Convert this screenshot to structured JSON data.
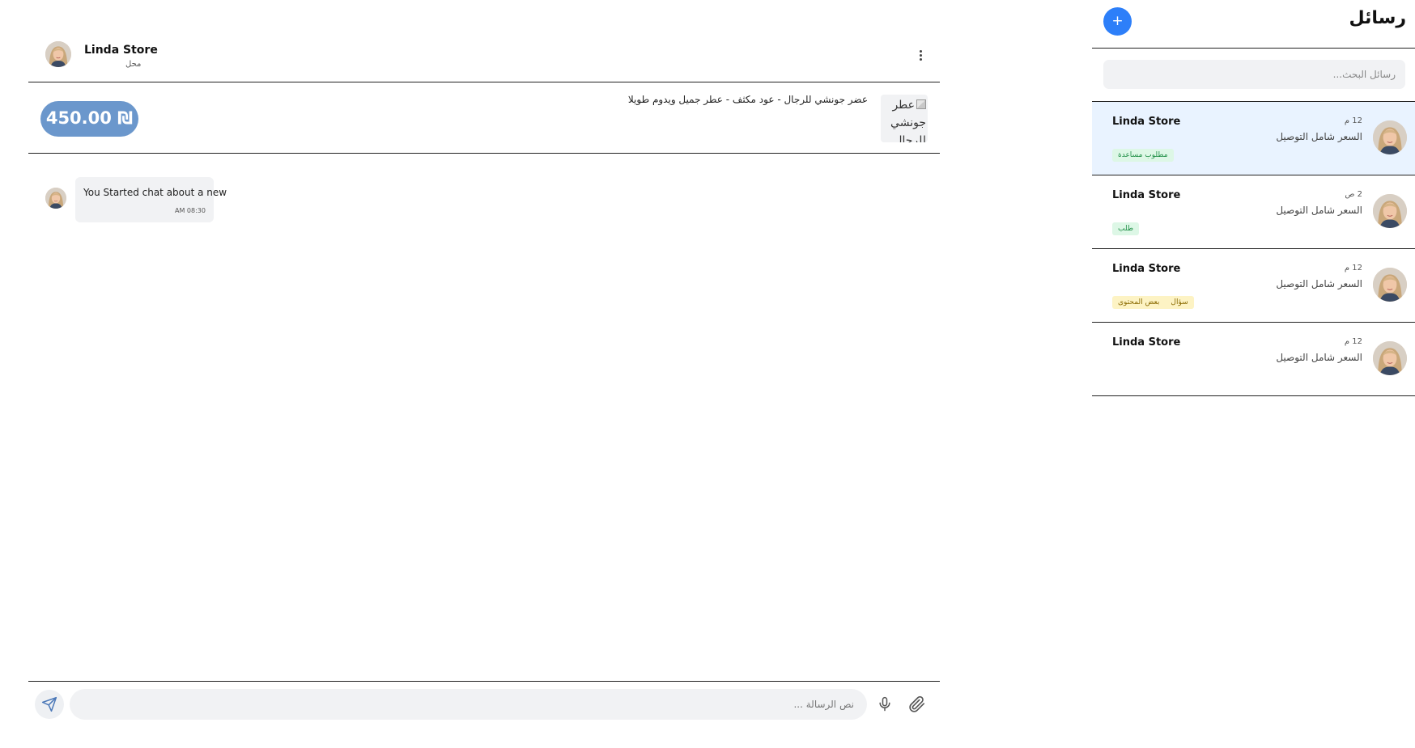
{
  "sidebar": {
    "title": "رسائل",
    "new_button_label": "+",
    "search_placeholder": "رسائل البحث...",
    "conversations": [
      {
        "name": "Linda Store",
        "time": "12 م",
        "preview": "السعر شامل التوصيل",
        "tags": [
          "مطلوب مساعدة"
        ],
        "tag_colors": [
          "green"
        ],
        "active": true
      },
      {
        "name": "Linda Store",
        "time": "2 ص",
        "preview": "السعر شامل التوصيل",
        "tags": [
          "طلب"
        ],
        "tag_colors": [
          "green"
        ],
        "active": false
      },
      {
        "name": "Linda Store",
        "time": "12 م",
        "preview": "السعر شامل التوصيل",
        "tags": [
          "سؤال",
          "بعض المحتوى"
        ],
        "tag_colors": [
          "yellow"
        ],
        "active": false
      },
      {
        "name": "Linda Store",
        "time": "12 م",
        "preview": "السعر شامل التوصيل",
        "tags": [],
        "tag_colors": [],
        "active": false
      }
    ]
  },
  "chat": {
    "contact_name": "Linda Store",
    "contact_subtitle": "محل",
    "menu_icon": "more-vertical-icon",
    "product": {
      "title": "عضر جونشي للرجال - عود مكثف - عطر جميل ويدوم طويلا",
      "image_alt": "عطر جونشي للرجال -",
      "price": "450.00 ₪"
    },
    "messages": [
      {
        "text": "You Started chat about a new",
        "time": "AM 08:30"
      }
    ],
    "composer": {
      "placeholder": "نص الرسالة ...",
      "send_icon": "send-icon",
      "mic_icon": "microphone-icon",
      "attach_icon": "paperclip-icon"
    }
  },
  "colors": {
    "accent": "#2d7ff9",
    "price_pill": "#6b97cc",
    "active_row": "#e9f3ff",
    "tag_green_bg": "#ddf7e6",
    "tag_yellow_bg": "#fdf3c4"
  }
}
